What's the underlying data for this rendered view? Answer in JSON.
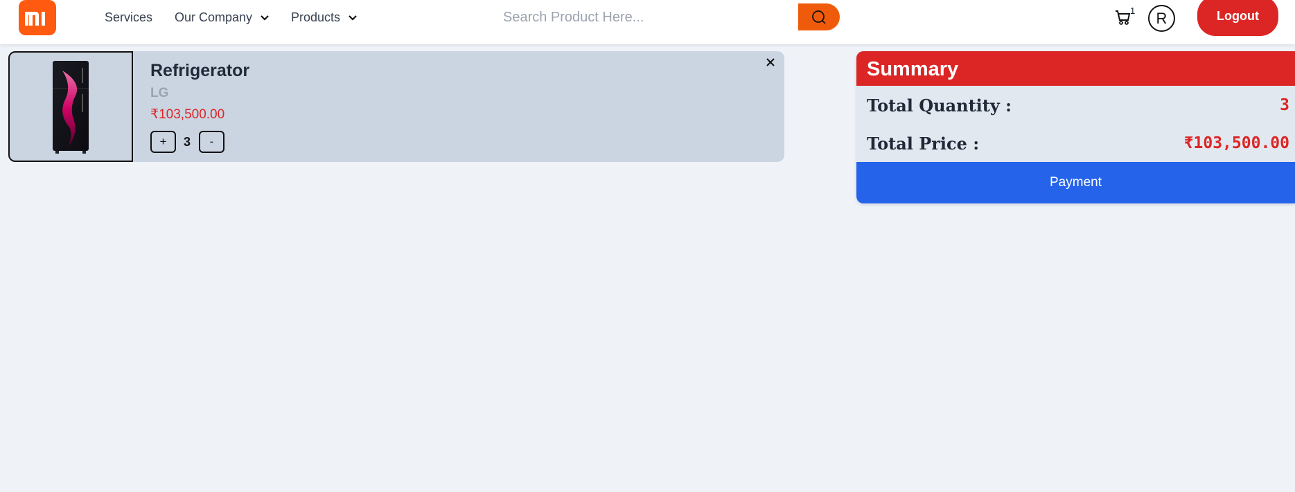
{
  "header": {
    "logo_text": "mi",
    "nav": {
      "services": "Services",
      "company": "Our Company",
      "products": "Products"
    },
    "search": {
      "placeholder": "Search Product Here...",
      "value": ""
    },
    "cart_count": "1",
    "avatar_initial": "R",
    "logout_label": "Logout"
  },
  "cart": {
    "items": [
      {
        "name": "Refrigerator",
        "brand": "LG",
        "price": "₹103,500.00",
        "quantity": "3",
        "plus_label": "+",
        "minus_label": "-"
      }
    ]
  },
  "summary": {
    "title": "Summary",
    "quantity_label": "Total Quantity :",
    "quantity_value": "3",
    "price_label": "Total Price :",
    "price_value": "₹103,500.00",
    "payment_label": "Payment"
  },
  "colors": {
    "brand_orange": "#ff5a0f",
    "accent_red": "#dc2626",
    "payment_blue": "#2563eb",
    "page_bg": "#eff3f8",
    "card_bg": "#cbd5e1"
  },
  "icons": {
    "logo": "mi-logo-icon",
    "search": "search-icon",
    "cart": "cart-icon",
    "chevron": "chevron-down-icon",
    "close": "close-icon"
  }
}
